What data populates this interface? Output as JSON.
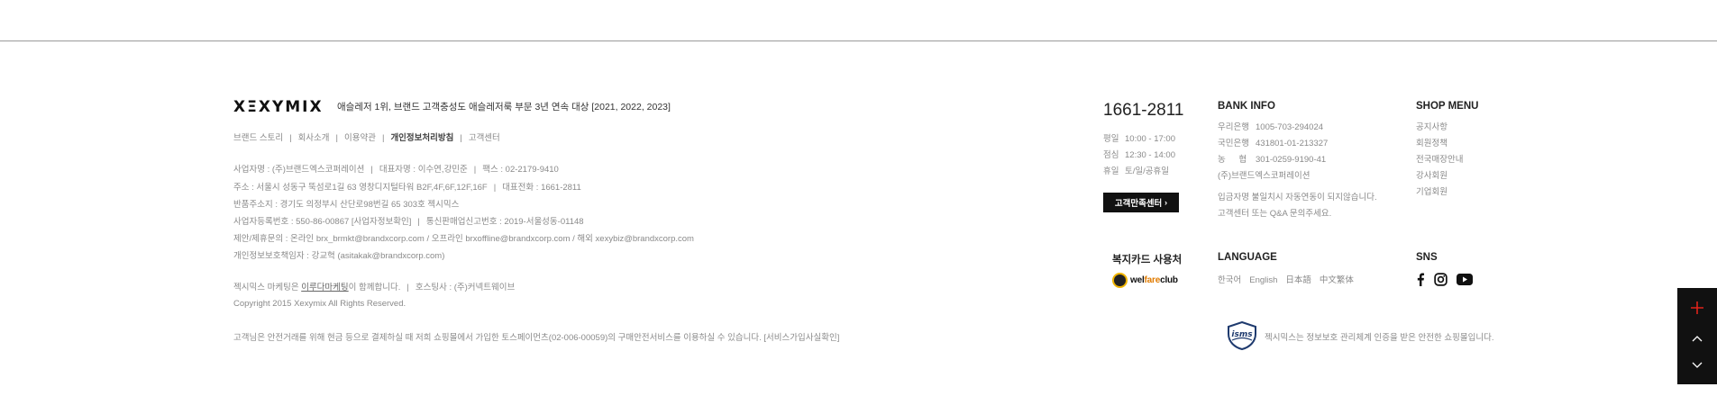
{
  "brand": {
    "logo": "XΞXYMIX",
    "tagline": "애슬레저 1위, 브랜드 고객충성도 애슬레저룩 부문 3년 연속 대상 [2021, 2022, 2023]"
  },
  "footer_links": [
    {
      "label": "브랜드 스토리",
      "bold": false
    },
    {
      "label": "회사소개",
      "bold": false
    },
    {
      "label": "이용약관",
      "bold": false
    },
    {
      "label": "개인정보처리방침",
      "bold": true
    },
    {
      "label": "고객센터",
      "bold": false
    }
  ],
  "company": {
    "line1": [
      "사업자명 : (주)브랜드엑스코퍼레이션",
      "대표자명 : 이수연,강민준",
      "팩스 : 02-2179-9410"
    ],
    "line2": [
      "주소 : 서울시 성동구 뚝섬로1길 63 영창디지털타워 B2F,4F,6F,12F,16F",
      "대표전화 : 1661-2811"
    ],
    "line3": "반품주소지 : 경기도 의정부시 산단로98번길 65 303호 젝시믹스",
    "line4": [
      "사업자등록번호 : 550-86-00867 [사업자정보확인]",
      "통신판매업신고번호 : 2019-서울성동-01148"
    ],
    "line5": "제안/제휴문의 : 온라인 brx_brmkt@brandxcorp.com / 오프라인 brxoffline@brandxcorp.com / 해외 xexybiz@brandxcorp.com",
    "line6": "개인정보보호책임자 : 강교혁 (asitakak@brandxcorp.com)",
    "marketing_prefix": "젝시믹스 마케팅은 ",
    "marketing_link": "이루다마케팅",
    "marketing_suffix": "이 함께합니다.",
    "hosting": "호스팅사 : (주)커넥트웨이브",
    "copyright": "Copyright 2015 Xexymix All Rights Reserved."
  },
  "notice": "고객님은 안전거래를 위해 현금 등으로 결제하실 때 저희 쇼핑몰에서 가입한 토스페이먼츠(02-006-00059)의 구매안전서비스를 이용하실 수 있습니다. [서비스가입사실확인]",
  "cs": {
    "phone": "1661-2811",
    "hours": [
      {
        "k": "평일",
        "v": "10:00 - 17:00"
      },
      {
        "k": "점심",
        "v": "12:30 - 14:00"
      },
      {
        "k": "휴일",
        "v": "토/일/공휴일"
      }
    ],
    "button": "고객만족센터",
    "button_arrow": "›"
  },
  "bank": {
    "title": "BANK INFO",
    "accounts": [
      {
        "bank": "우리은행",
        "number": "1005-703-294024"
      },
      {
        "bank": "국민은행",
        "number": "431801-01-213327"
      },
      {
        "bank": "농 협",
        "number": "301-0259-9190-41"
      }
    ],
    "holder": "(주)브랜드엑스코퍼레이션",
    "note1": "입금자명 불일치시 자동연동이 되지않습니다.",
    "note2": "고객센터 또는 Q&A 문의주세요."
  },
  "shop_menu": {
    "title": "SHOP MENU",
    "items": [
      "공지사항",
      "회원정책",
      "전국매장안내",
      "강사회원",
      "기업회원"
    ]
  },
  "welfare": {
    "title": "복지카드 사용처",
    "logo_a": "wel",
    "logo_b": "fare",
    "logo_c": "club"
  },
  "language": {
    "title": "LANGUAGE",
    "options": [
      "한국어",
      "English",
      "日本語",
      "中文繁体"
    ]
  },
  "sns": {
    "title": "SNS",
    "icons": [
      "facebook-icon",
      "instagram-icon",
      "youtube-icon"
    ]
  },
  "isms": {
    "badge": "isms",
    "text": "젝시믹스는 정보보호 관리체계 인증을 받은 안전한 쇼핑몰입니다."
  },
  "float_menu": {
    "icons": [
      "plus-icon",
      "chevron-up-icon",
      "chevron-down-icon"
    ],
    "accent": "#e0231b"
  }
}
